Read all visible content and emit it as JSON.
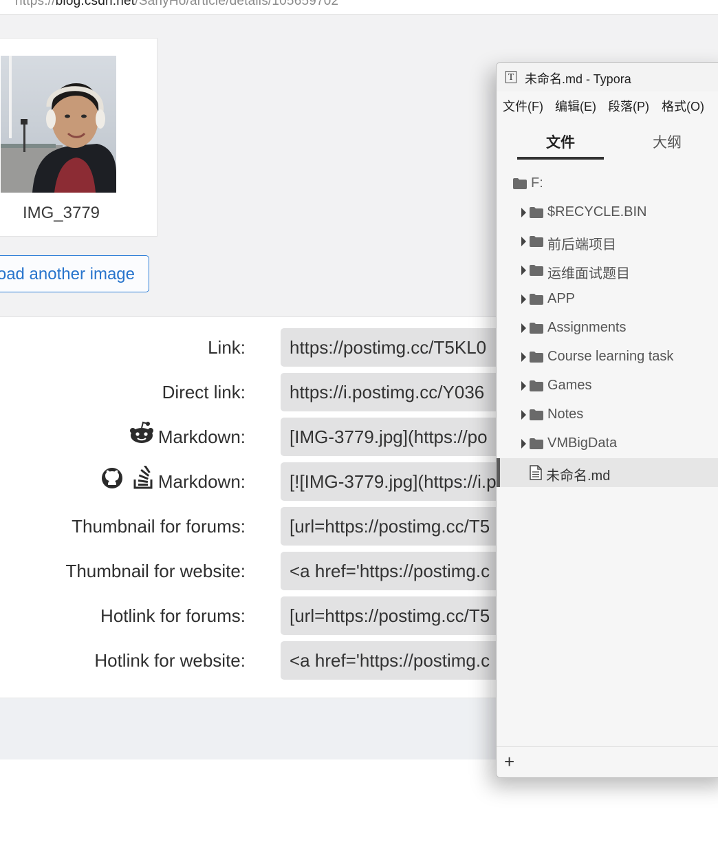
{
  "browser": {
    "url_prefix": "https://",
    "url_domain": "blog.csdn.net",
    "url_path": "/SanyHo/article/details/105659702"
  },
  "image_card": {
    "caption": "IMG_3779"
  },
  "upload_button": {
    "label": "load another image"
  },
  "link_rows": [
    {
      "label": "Link:",
      "value": "https://postimg.cc/T5KL0",
      "icons": []
    },
    {
      "label": "Direct link:",
      "value": "https://i.postimg.cc/Y036",
      "icons": []
    },
    {
      "label": "Markdown:",
      "value": "[IMG-3779.jpg](https://po",
      "icons": [
        "reddit-icon"
      ]
    },
    {
      "label": "Markdown:",
      "value": "[![IMG-3779.jpg](https://i.p",
      "icons": [
        "github-icon",
        "stackoverflow-icon"
      ]
    },
    {
      "label": "Thumbnail for forums:",
      "value": "[url=https://postimg.cc/T5",
      "icons": []
    },
    {
      "label": "Thumbnail for website:",
      "value": "<a href='https://postimg.c",
      "icons": []
    },
    {
      "label": "Hotlink for forums:",
      "value": "[url=https://postimg.cc/T5",
      "icons": []
    },
    {
      "label": "Hotlink for website:",
      "value": "<a href='https://postimg.c",
      "icons": []
    }
  ],
  "typora": {
    "app_icon": "T",
    "title": "未命名.md - Typora",
    "menu": [
      "文件(F)",
      "编辑(E)",
      "段落(P)",
      "格式(O)"
    ],
    "tabs": {
      "files": "文件",
      "outline": "大纲",
      "active": "files"
    },
    "root": "F:",
    "folders": [
      "$RECYCLE.BIN",
      "前后端项目",
      "运维面试题目",
      "APP",
      "Assignments",
      "Course learning task",
      "Games",
      "Notes",
      "VMBigData"
    ],
    "selected_file": "未命名.md",
    "status_plus": "+"
  }
}
